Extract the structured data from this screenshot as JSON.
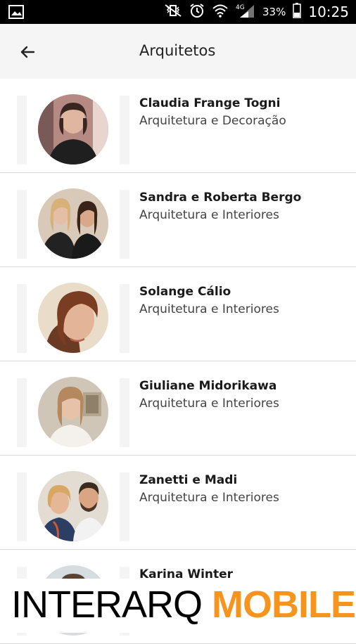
{
  "status": {
    "battery": "33%",
    "time": "10:25",
    "network": "4G"
  },
  "appbar": {
    "title": "Arquitetos"
  },
  "items": [
    {
      "name": "Claudia Frange Togni",
      "category": "Arquitetura e Decoração"
    },
    {
      "name": "Sandra e Roberta Bergo",
      "category": "Arquitetura e Interiores"
    },
    {
      "name": "Solange Cálio",
      "category": "Arquitetura e Interiores"
    },
    {
      "name": "Giuliane Midorikawa",
      "category": "Arquitetura e Interiores"
    },
    {
      "name": "Zanetti e Madi",
      "category": "Arquitetura e Interiores"
    },
    {
      "name": "Karina Winter",
      "category": ""
    }
  ],
  "footer": {
    "brand_part1": "INTERARQ",
    "brand_part2": "MOBILE"
  },
  "colors": {
    "accent": "#f7941d",
    "appbar": "#f5f5f5",
    "statusbar": "#000000"
  }
}
